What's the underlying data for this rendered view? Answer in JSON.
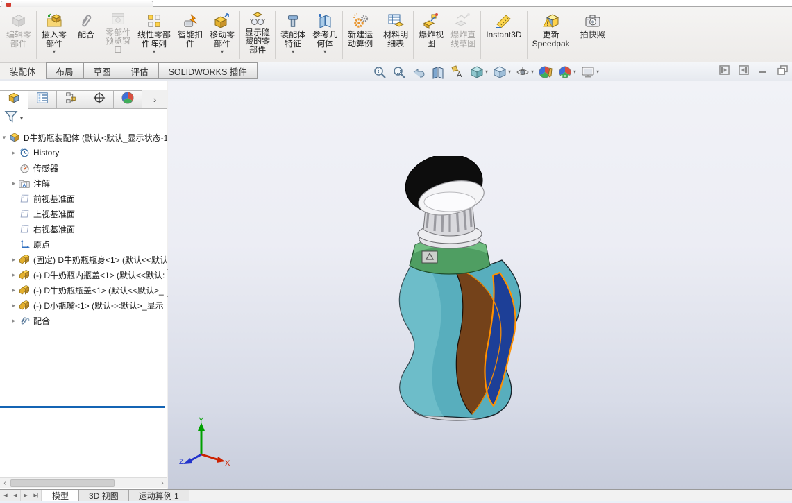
{
  "ribbon": {
    "groups": [
      {
        "buttons": [
          {
            "label_lines": [
              "编辑零",
              "部件"
            ],
            "icon": "edit-component-icon",
            "disabled": true,
            "dropdown": false
          }
        ]
      },
      {
        "buttons": [
          {
            "label_lines": [
              "插入零",
              "部件"
            ],
            "icon": "insert-component-icon",
            "disabled": false,
            "dropdown": true
          },
          {
            "label_lines": [
              "配合"
            ],
            "icon": "mate-icon",
            "disabled": false,
            "dropdown": false
          },
          {
            "label_lines": [
              "零部件",
              "预览窗",
              "口"
            ],
            "icon": "component-preview-icon",
            "disabled": true,
            "dropdown": false
          },
          {
            "label_lines": [
              "线性零部",
              "件阵列"
            ],
            "icon": "linear-pattern-icon",
            "disabled": false,
            "dropdown": true
          },
          {
            "label_lines": [
              "智能扣",
              "件"
            ],
            "icon": "smart-fasteners-icon",
            "disabled": false,
            "dropdown": false
          },
          {
            "label_lines": [
              "移动零",
              "部件"
            ],
            "icon": "move-component-icon",
            "disabled": false,
            "dropdown": true
          }
        ]
      },
      {
        "buttons": [
          {
            "label_lines": [
              "显示隐",
              "藏的零",
              "部件"
            ],
            "icon": "show-hidden-icon",
            "disabled": false,
            "dropdown": false
          }
        ]
      },
      {
        "buttons": [
          {
            "label_lines": [
              "装配体",
              "特征"
            ],
            "icon": "assembly-features-icon",
            "disabled": false,
            "dropdown": true
          },
          {
            "label_lines": [
              "参考几",
              "何体"
            ],
            "icon": "reference-geometry-icon",
            "disabled": false,
            "dropdown": true
          }
        ]
      },
      {
        "buttons": [
          {
            "label_lines": [
              "新建运",
              "动算例"
            ],
            "icon": "motion-study-icon",
            "disabled": false,
            "dropdown": false
          }
        ]
      },
      {
        "buttons": [
          {
            "label_lines": [
              "材料明",
              "细表"
            ],
            "icon": "bom-icon",
            "disabled": false,
            "dropdown": false
          }
        ]
      },
      {
        "buttons": [
          {
            "label_lines": [
              "爆炸视",
              "图"
            ],
            "icon": "exploded-view-icon",
            "disabled": false,
            "dropdown": false
          },
          {
            "label_lines": [
              "爆炸直",
              "线草图"
            ],
            "icon": "explode-sketch-icon",
            "disabled": true,
            "dropdown": false
          }
        ]
      },
      {
        "buttons": [
          {
            "label_lines": [
              "Instant3D"
            ],
            "icon": "instant3d-icon",
            "disabled": false,
            "dropdown": false
          }
        ]
      },
      {
        "buttons": [
          {
            "label_lines": [
              "更新",
              "Speedpak"
            ],
            "icon": "speedpak-icon",
            "disabled": false,
            "dropdown": false
          }
        ]
      },
      {
        "buttons": [
          {
            "label_lines": [
              "拍快照"
            ],
            "icon": "snapshot-icon",
            "disabled": false,
            "dropdown": false
          }
        ]
      }
    ]
  },
  "command_tabs": {
    "items": [
      {
        "label": "装配体",
        "active": true
      },
      {
        "label": "布局",
        "active": false
      },
      {
        "label": "草图",
        "active": false
      },
      {
        "label": "评估",
        "active": false
      },
      {
        "label": "SOLIDWORKS 插件",
        "active": false
      }
    ]
  },
  "headsup": {
    "items": [
      {
        "icon": "zoom-fit-icon",
        "dropdown": false
      },
      {
        "icon": "zoom-to-area-icon",
        "dropdown": false
      },
      {
        "icon": "previous-view-icon",
        "dropdown": false
      },
      {
        "icon": "section-view-icon",
        "dropdown": false
      },
      {
        "icon": "annotation-views-icon",
        "dropdown": false
      },
      {
        "icon": "view-orientation-icon",
        "dropdown": true
      },
      {
        "icon": "display-style-icon",
        "dropdown": true
      },
      {
        "icon": "hide-show-items-icon",
        "dropdown": true
      },
      {
        "icon": "edit-appearance-icon",
        "dropdown": false
      },
      {
        "icon": "apply-scene-icon",
        "dropdown": true
      },
      {
        "icon": "view-settings-icon",
        "dropdown": true
      }
    ]
  },
  "window_controls": [
    {
      "name": "collapse-left-pane-button",
      "glyph": "pane-left"
    },
    {
      "name": "collapse-right-pane-button",
      "glyph": "pane-right"
    },
    {
      "name": "minimize-button",
      "glyph": "minimize"
    },
    {
      "name": "restore-button",
      "glyph": "restore"
    }
  ],
  "feature_panel": {
    "tabs": [
      {
        "icon": "feature-manager-tab-icon",
        "active": true
      },
      {
        "icon": "property-manager-tab-icon",
        "active": false
      },
      {
        "icon": "configuration-manager-tab-icon",
        "active": false
      },
      {
        "icon": "dimxpert-tab-icon",
        "active": false
      },
      {
        "icon": "display-manager-tab-icon",
        "active": false
      }
    ],
    "more_arrow": "›",
    "filter_icon": "filter-funnel-icon",
    "tree": {
      "root": {
        "label": "D牛奶瓶装配体  (默认<默认_显示状态-1>",
        "icon": "assembly-icon",
        "arrow": "▾"
      },
      "items": [
        {
          "label": "History",
          "icon": "history-icon",
          "arrow": "▸"
        },
        {
          "label": "传感器",
          "icon": "sensors-icon",
          "arrow": ""
        },
        {
          "label": "注解",
          "icon": "annotations-icon",
          "arrow": "▸"
        },
        {
          "label": "前视基准面",
          "icon": "plane-icon",
          "arrow": ""
        },
        {
          "label": "上视基准面",
          "icon": "plane-icon",
          "arrow": ""
        },
        {
          "label": "右视基准面",
          "icon": "plane-icon",
          "arrow": ""
        },
        {
          "label": "原点",
          "icon": "origin-icon",
          "arrow": ""
        },
        {
          "label": "(固定) D牛奶瓶瓶身<1> (默认<<默认",
          "icon": "component-icon",
          "arrow": "▸"
        },
        {
          "label": "(-) D牛奶瓶内瓶盖<1> (默认<<默认:",
          "icon": "component-icon",
          "arrow": "▸"
        },
        {
          "label": "(-) D牛奶瓶瓶盖<1> (默认<<默认>_",
          "icon": "component-icon",
          "arrow": "▸"
        },
        {
          "label": "(-) D小瓶嘴<1> (默认<<默认>_显示",
          "icon": "component-icon",
          "arrow": "▸"
        },
        {
          "label": "配合",
          "icon": "mates-icon",
          "arrow": "▸"
        }
      ]
    },
    "hscroll": {
      "left_arrow": "‹",
      "right_arrow": "›"
    }
  },
  "viewport": {
    "triad": {
      "x_label": "X",
      "y_label": "Y",
      "z_label": "Z",
      "x_color": "#cc2200",
      "y_color": "#00a000",
      "z_color": "#2233cc"
    },
    "model_colors": {
      "cap": "#0d0d0d",
      "cap_inner": "#f4f4f6",
      "neck": "#d9d9dd",
      "flange": "#e6e6ea",
      "collar": "#4f9e62",
      "body": "#58aebd",
      "patch": "#74421a",
      "stripe": "#1d3f97",
      "stripe_outline": "#ff9000",
      "base": "#d4d5da"
    },
    "background_top": "#f1f2f7",
    "background_bottom": "#c7ccdb"
  },
  "bottom_bar": {
    "nav": [
      "|◀",
      "◀",
      "▶",
      "▶|"
    ],
    "tabs": [
      {
        "label": "模型",
        "active": true
      },
      {
        "label": "3D 视图",
        "active": false
      },
      {
        "label": "运动算例 1",
        "active": false
      }
    ]
  }
}
